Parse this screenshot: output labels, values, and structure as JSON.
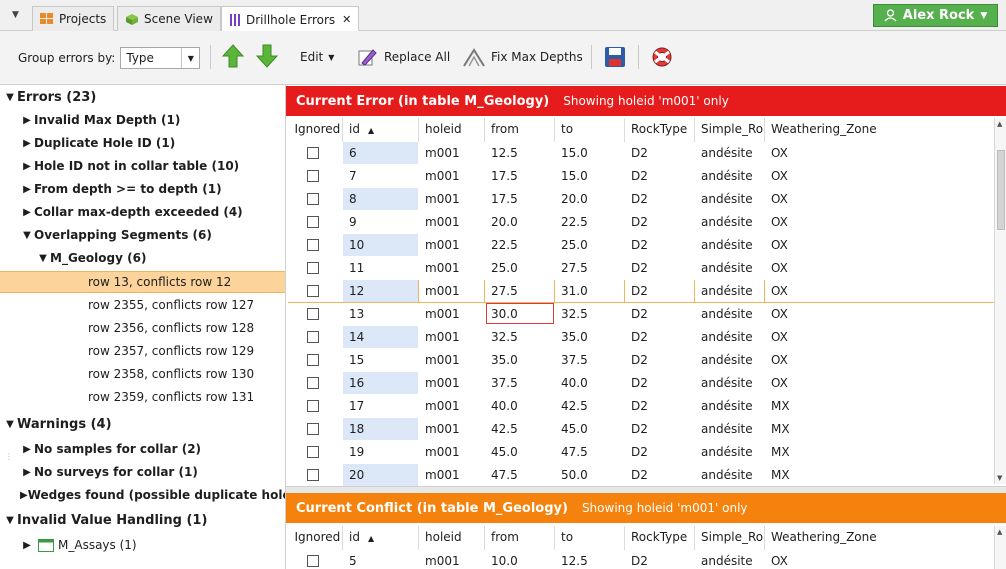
{
  "tabs": [
    {
      "label": "Projects",
      "icon": "projects-icon"
    },
    {
      "label": "Scene View",
      "icon": "cube-icon"
    },
    {
      "label": "Drillhole Errors",
      "icon": "drillhole-icon",
      "active": true
    }
  ],
  "user": {
    "name": "Alex Rock"
  },
  "toolbar": {
    "group_by_label": "Group errors by:",
    "group_by_value": "Type",
    "edit_label": "Edit",
    "replace_all_label": "Replace All",
    "fix_max_depths_label": "Fix Max Depths"
  },
  "tree": {
    "errors_header": "Errors (23)",
    "invalid_max_depth": "Invalid Max Depth (1)",
    "duplicate_hole_id": "Duplicate Hole ID (1)",
    "hole_not_in_collar": "Hole ID not in collar table (10)",
    "from_depth": "From depth >= to depth (1)",
    "collar_max_depth": "Collar max-depth exceeded (4)",
    "overlapping": "Overlapping Segments (6)",
    "m_geology": "M_Geology (6)",
    "conflicts": [
      "row 13, conflicts row 12",
      "row 2355, conflicts row 127",
      "row 2356, conflicts row 128",
      "row 2357, conflicts row 129",
      "row 2358, conflicts row 130",
      "row 2359, conflicts row 131"
    ],
    "warnings_header": "Warnings (4)",
    "no_samples": "No samples for collar (2)",
    "no_surveys": "No surveys for collar (1)",
    "wedges": "Wedges found (possible duplicate holes)",
    "invalid_value_header": "Invalid Value Handling (1)",
    "m_assays": "M_Assays (1)"
  },
  "current_error": {
    "title": "Current Error (in table M_Geology)",
    "subtitle": "Showing holeid 'm001' only"
  },
  "current_conflict": {
    "title": "Current Conflict (in table M_Geology)",
    "subtitle": "Showing holeid 'm001' only"
  },
  "columns": [
    "Ignored",
    "id",
    "holeid",
    "from",
    "to",
    "RockType",
    "Simple_Ro",
    "Weathering_Zone"
  ],
  "error_rows": [
    {
      "id": "6",
      "holeid": "m001",
      "from": "12.5",
      "to": "15.0",
      "rock": "D2",
      "simple": "andésite",
      "weather": "OX"
    },
    {
      "id": "7",
      "holeid": "m001",
      "from": "17.5",
      "to": "15.0",
      "rock": "D2",
      "simple": "andésite",
      "weather": "OX"
    },
    {
      "id": "8",
      "holeid": "m001",
      "from": "17.5",
      "to": "20.0",
      "rock": "D2",
      "simple": "andésite",
      "weather": "OX"
    },
    {
      "id": "9",
      "holeid": "m001",
      "from": "20.0",
      "to": "22.5",
      "rock": "D2",
      "simple": "andésite",
      "weather": "OX"
    },
    {
      "id": "10",
      "holeid": "m001",
      "from": "22.5",
      "to": "25.0",
      "rock": "D2",
      "simple": "andésite",
      "weather": "OX"
    },
    {
      "id": "11",
      "holeid": "m001",
      "from": "25.0",
      "to": "27.5",
      "rock": "D2",
      "simple": "andésite",
      "weather": "OX"
    },
    {
      "id": "12",
      "holeid": "m001",
      "from": "27.5",
      "to": "31.0",
      "rock": "D2",
      "simple": "andésite",
      "weather": "OX"
    },
    {
      "id": "13",
      "holeid": "m001",
      "from": "30.0",
      "to": "32.5",
      "rock": "D2",
      "simple": "andésite",
      "weather": "OX"
    },
    {
      "id": "14",
      "holeid": "m001",
      "from": "32.5",
      "to": "35.0",
      "rock": "D2",
      "simple": "andésite",
      "weather": "OX"
    },
    {
      "id": "15",
      "holeid": "m001",
      "from": "35.0",
      "to": "37.5",
      "rock": "D2",
      "simple": "andésite",
      "weather": "OX"
    },
    {
      "id": "16",
      "holeid": "m001",
      "from": "37.5",
      "to": "40.0",
      "rock": "D2",
      "simple": "andésite",
      "weather": "OX"
    },
    {
      "id": "17",
      "holeid": "m001",
      "from": "40.0",
      "to": "42.5",
      "rock": "D2",
      "simple": "andésite",
      "weather": "MX"
    },
    {
      "id": "18",
      "holeid": "m001",
      "from": "42.5",
      "to": "45.0",
      "rock": "D2",
      "simple": "andésite",
      "weather": "MX"
    },
    {
      "id": "19",
      "holeid": "m001",
      "from": "45.0",
      "to": "47.5",
      "rock": "D2",
      "simple": "andésite",
      "weather": "MX"
    },
    {
      "id": "20",
      "holeid": "m001",
      "from": "47.5",
      "to": "50.0",
      "rock": "D2",
      "simple": "andésite",
      "weather": "MX"
    }
  ],
  "conflict_rows": [
    {
      "id": "5",
      "holeid": "m001",
      "from": "10.0",
      "to": "12.5",
      "rock": "D2",
      "simple": "andésite",
      "weather": "OX"
    }
  ],
  "colors": {
    "error_header": "#e61b1b",
    "conflict_header": "#f5820c",
    "selection": "#fbd39b",
    "user_button": "#55b04d"
  }
}
